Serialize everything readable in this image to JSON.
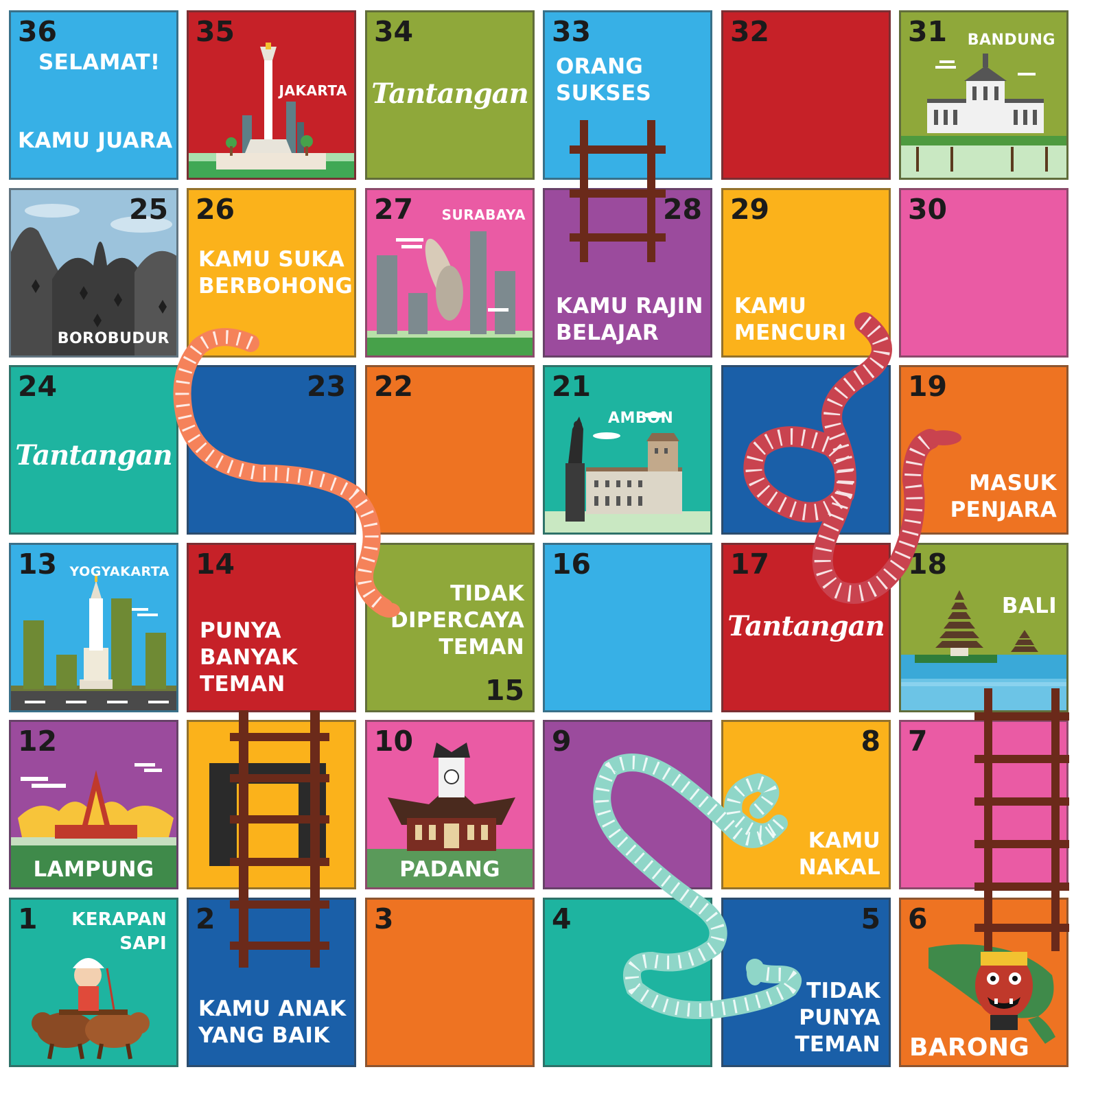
{
  "colors": {
    "red": "#c62128",
    "green": "#8fa83a",
    "sky": "#37b0e6",
    "navy": "#1a5fa8",
    "orange": "#ee7322",
    "yellow": "#fbb21b",
    "pink": "#ea5ba4",
    "purple": "#9b4b9d",
    "teal": "#1eb4a0",
    "ladder": "#6b2a1a"
  },
  "tiles": {
    "t36": {
      "num": "36",
      "line1": "SELAMAT!",
      "line2": "KAMU JUARA"
    },
    "t35": {
      "num": "35",
      "city": "JAKARTA"
    },
    "t34": {
      "num": "34",
      "challenge": "Tantangan"
    },
    "t33": {
      "num": "33",
      "text": "ORANG\nSUKSES"
    },
    "t32": {
      "num": "32"
    },
    "t31": {
      "num": "31",
      "city": "BANDUNG"
    },
    "t25": {
      "num": "25",
      "city": "BOROBUDUR"
    },
    "t26": {
      "num": "26",
      "text": "KAMU SUKA\nBERBOHONG"
    },
    "t27": {
      "num": "27",
      "city": "SURABAYA"
    },
    "t28": {
      "num": "28",
      "text": "KAMU RAJIN\nBELAJAR"
    },
    "t29": {
      "num": "29",
      "text": "KAMU\nMENCURI"
    },
    "t30": {
      "num": "30"
    },
    "t24": {
      "num": "24",
      "challenge": "Tantangan"
    },
    "t23": {
      "num": "23"
    },
    "t22": {
      "num": "22"
    },
    "t21": {
      "num": "21",
      "city": "AMBON"
    },
    "t20": {
      "num": ""
    },
    "t19": {
      "num": "19",
      "text": "MASUK\nPENJARA"
    },
    "t13": {
      "num": "13",
      "city": "YOGYAKARTA"
    },
    "t14": {
      "num": "14",
      "text": "PUNYA\nBANYAK\nTEMAN"
    },
    "t15": {
      "num": "15",
      "text": "TIDAK\nDIPERCAYA\nTEMAN"
    },
    "t16": {
      "num": "16"
    },
    "t17": {
      "num": "17",
      "challenge": "Tantangan"
    },
    "t18": {
      "num": "18",
      "city": "BALI"
    },
    "t12": {
      "num": "12",
      "city": "LAMPUNG"
    },
    "t11": {
      "num": ""
    },
    "t10": {
      "num": "10",
      "city": "PADANG"
    },
    "t9": {
      "num": "9"
    },
    "t8": {
      "num": "8",
      "text": "KAMU\nNAKAL"
    },
    "t7": {
      "num": "7"
    },
    "t1": {
      "num": "1",
      "text": "KERAPAN\nSAPI"
    },
    "t2": {
      "num": "2",
      "text": "KAMU ANAK\nYANG BAIK"
    },
    "t3": {
      "num": "3"
    },
    "t4": {
      "num": "4"
    },
    "t5": {
      "num": "5",
      "text": "TIDAK\nPUNYA\nTEMAN"
    },
    "t6": {
      "num": "6",
      "city": "BARONG"
    }
  }
}
